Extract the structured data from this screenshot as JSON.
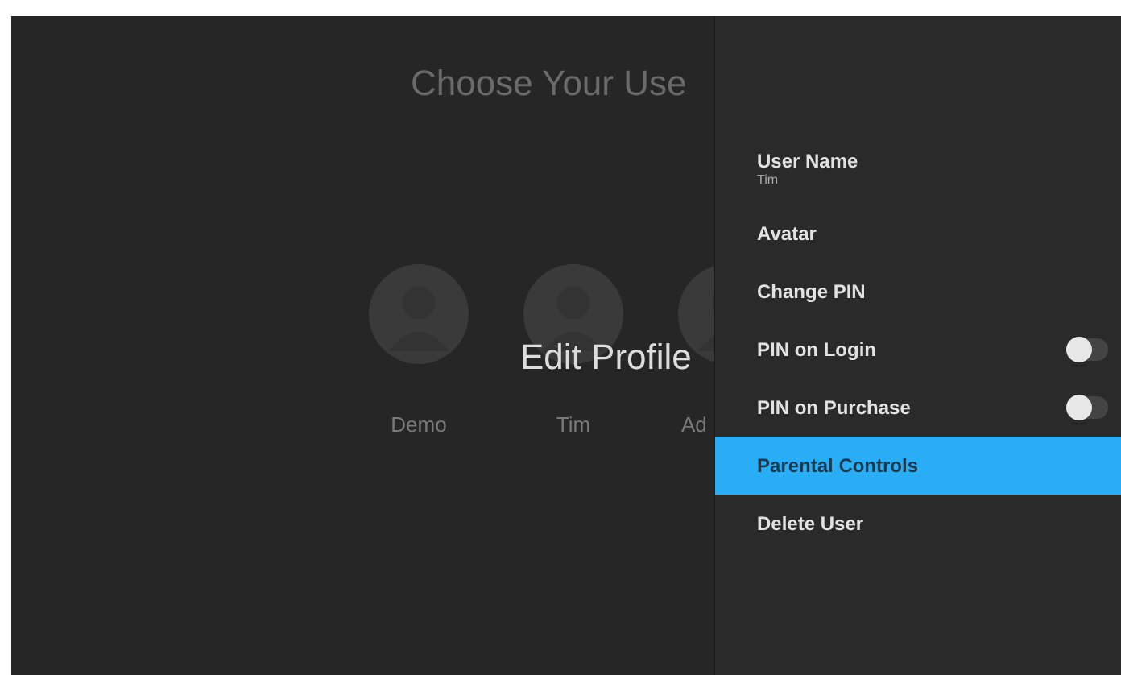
{
  "background": {
    "title": "Choose Your Use",
    "users": [
      {
        "name": "Demo"
      },
      {
        "name": "Tim"
      },
      {
        "name": "Ad"
      }
    ],
    "overlay_title": "Edit Profile"
  },
  "menu": {
    "items": [
      {
        "kind": "value",
        "label": "User Name",
        "value": "Tim",
        "selected": false
      },
      {
        "kind": "link",
        "label": "Avatar",
        "selected": false
      },
      {
        "kind": "link",
        "label": "Change PIN",
        "selected": false
      },
      {
        "kind": "toggle",
        "label": "PIN on Login",
        "on": false,
        "selected": false
      },
      {
        "kind": "toggle",
        "label": "PIN on Purchase",
        "on": false,
        "selected": false
      },
      {
        "kind": "link",
        "label": "Parental Controls",
        "selected": true
      },
      {
        "kind": "link",
        "label": "Delete User",
        "selected": false
      }
    ]
  }
}
